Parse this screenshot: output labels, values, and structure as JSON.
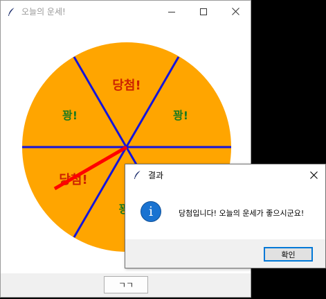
{
  "main_window": {
    "title": "오늘의 운세!",
    "icon": "feather-icon",
    "controls": [
      "minimize-icon",
      "maximize-icon",
      "close-icon"
    ]
  },
  "wheel": {
    "fill_color": "#ffa500",
    "divider_color": "#1414dc",
    "pointer_color": "#ff0000",
    "segments": [
      {
        "label": "당첨!",
        "color": "#cc2200"
      },
      {
        "label": "꽝!",
        "color": "#1e7a1e"
      },
      {
        "label": "꽝!",
        "color": "#1e7a1e"
      },
      {
        "label": "당첨!",
        "color": "#cc2200"
      },
      {
        "label": "꽝",
        "color": "#1e7a1e"
      }
    ]
  },
  "action_button": {
    "label": "ㄱㄱ"
  },
  "dialog": {
    "title": "결과",
    "icon": "info-icon",
    "message": "당첨입니다! 오늘의 운세가 좋으시군요!",
    "ok_label": "확인"
  }
}
